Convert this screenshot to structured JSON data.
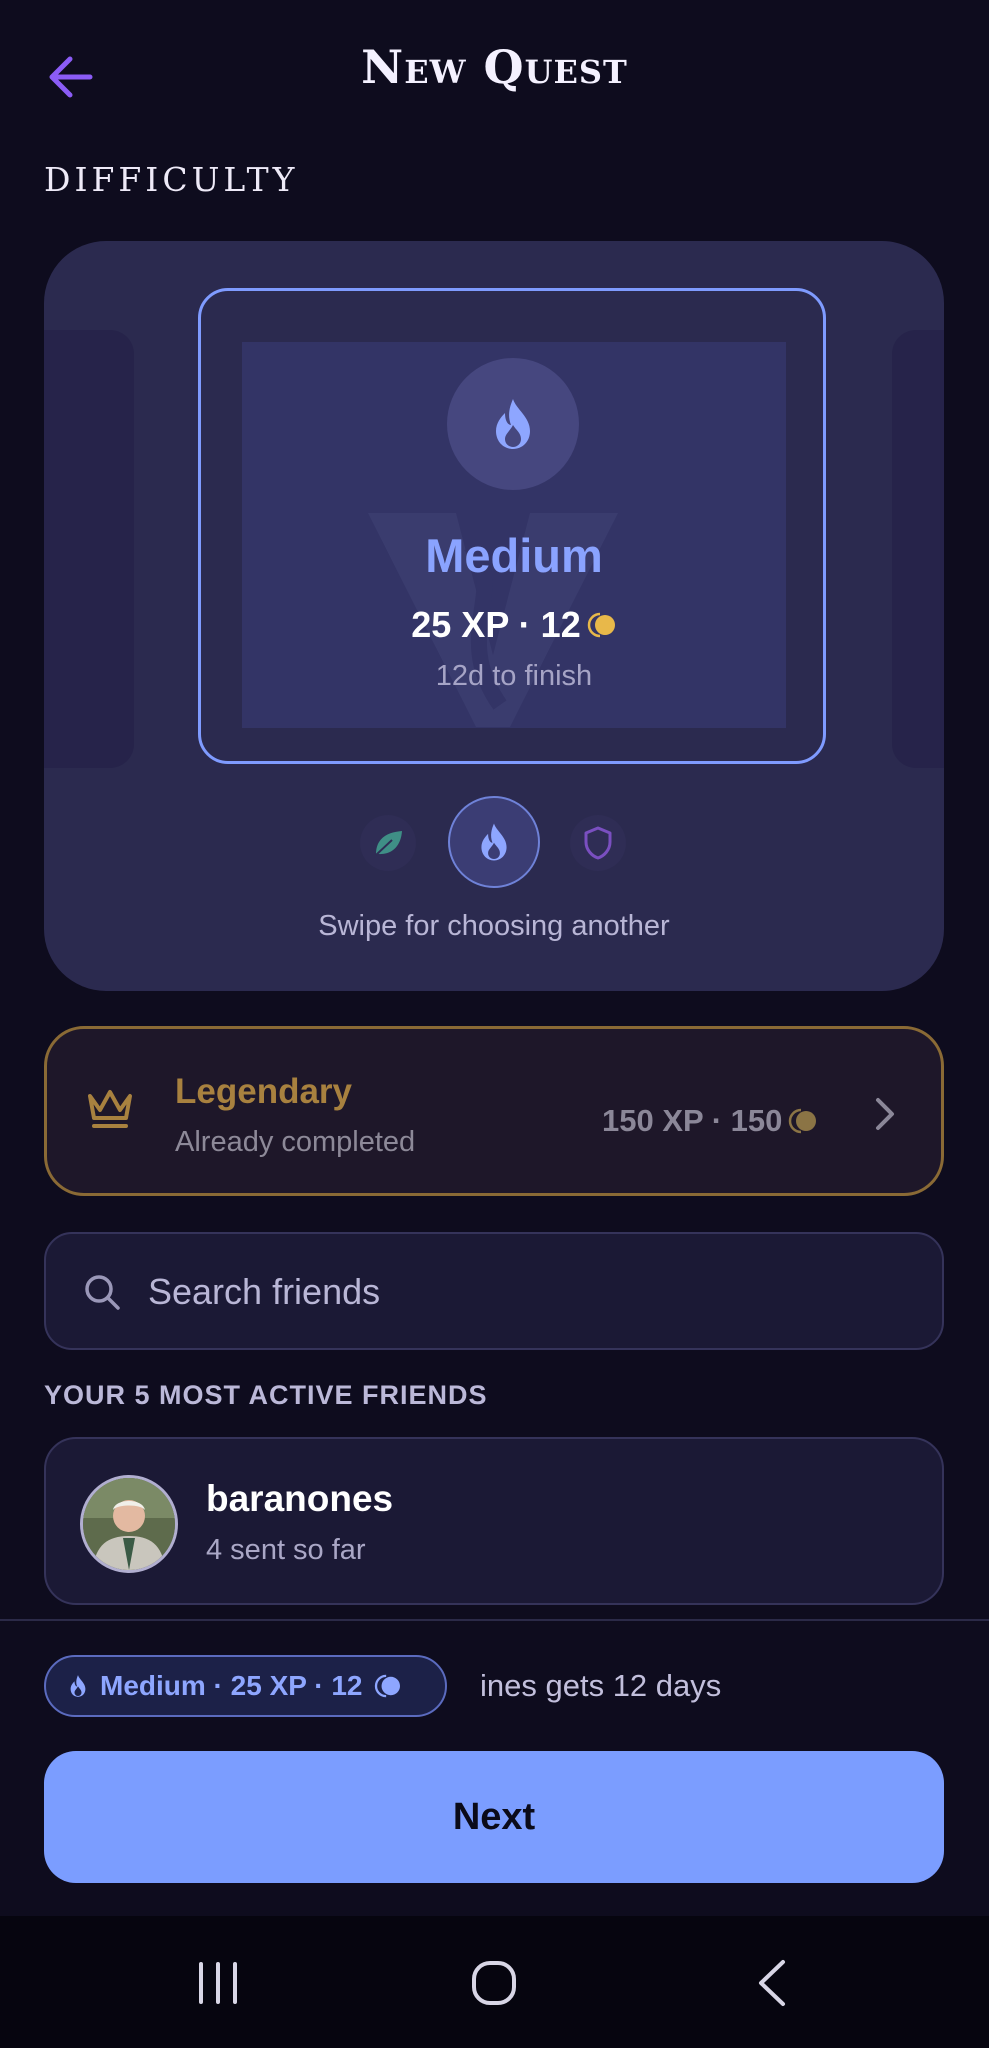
{
  "header": {
    "title": "New Quest"
  },
  "difficulty": {
    "section_label": "DIFFICULTY",
    "selected": {
      "name": "Medium",
      "reward": "25 XP · 12",
      "duration": "12d to finish",
      "accent": "#8aa3ff"
    },
    "options": [
      "leaf-icon",
      "flame-icon",
      "shield-icon"
    ],
    "hint": "Swipe for choosing another"
  },
  "legendary": {
    "name": "Legendary",
    "status": "Already completed",
    "reward": "150 XP · 150",
    "accent": "#a8813f"
  },
  "search": {
    "placeholder": "Search friends"
  },
  "friends": {
    "heading": "YOUR 5 MOST ACTIVE FRIENDS",
    "items": [
      {
        "name": "baranones",
        "sub": "4 sent so far"
      }
    ]
  },
  "summary": {
    "pill": "Medium · 25 XP · 12",
    "text": "ines gets 12 days"
  },
  "actions": {
    "next_label": "Next"
  },
  "colors": {
    "background": "#0e0c1e",
    "panel": "#2b2a4f",
    "primary": "#7b9dff",
    "coin": "#e8b84a"
  }
}
